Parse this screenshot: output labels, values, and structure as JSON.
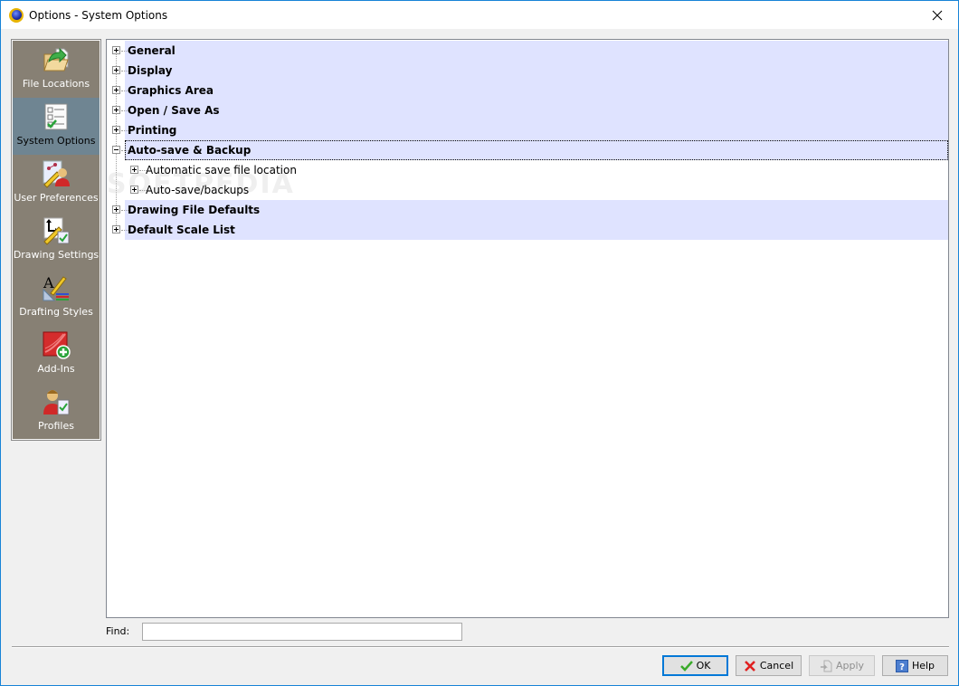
{
  "window": {
    "title": "Options - System Options",
    "app_icon": "app-logo-icon",
    "close_icon": "close-icon"
  },
  "sidebar": {
    "items": [
      {
        "label": "File Locations",
        "icon": "folder-arrow-icon",
        "selected": false
      },
      {
        "label": "System Options",
        "icon": "checklist-icon",
        "selected": true
      },
      {
        "label": "User Preferences",
        "icon": "user-preferences-icon",
        "selected": false
      },
      {
        "label": "Drawing Settings",
        "icon": "drawing-settings-icon",
        "selected": false
      },
      {
        "label": "Drafting Styles",
        "icon": "drafting-styles-icon",
        "selected": false
      },
      {
        "label": "Add-Ins",
        "icon": "add-ins-icon",
        "selected": false
      },
      {
        "label": "Profiles",
        "icon": "profiles-icon",
        "selected": false
      }
    ]
  },
  "tree": {
    "nodes": [
      {
        "label": "General",
        "level": 0,
        "expanded": false
      },
      {
        "label": "Display",
        "level": 0,
        "expanded": false
      },
      {
        "label": "Graphics Area",
        "level": 0,
        "expanded": false
      },
      {
        "label": "Open / Save As",
        "level": 0,
        "expanded": false
      },
      {
        "label": "Printing",
        "level": 0,
        "expanded": false
      },
      {
        "label": "Auto-save & Backup",
        "level": 0,
        "expanded": true,
        "focused": true
      },
      {
        "label": "Automatic save file location",
        "level": 1,
        "expanded": false
      },
      {
        "label": "Auto-save/backups",
        "level": 1,
        "expanded": false
      },
      {
        "label": "Drawing File Defaults",
        "level": 0,
        "expanded": false
      },
      {
        "label": "Default Scale List",
        "level": 0,
        "expanded": false
      }
    ],
    "highlight_color": "#dfe3ff"
  },
  "find": {
    "label": "Find:",
    "value": "",
    "placeholder": ""
  },
  "buttons": {
    "ok": {
      "label": "OK",
      "icon": "checkmark-icon"
    },
    "cancel": {
      "label": "Cancel",
      "icon": "x-icon"
    },
    "apply": {
      "label": "Apply",
      "icon": "apply-icon",
      "disabled": true
    },
    "help": {
      "label": "Help",
      "icon": "help-icon"
    }
  },
  "watermark": "SOFTPEDIA"
}
